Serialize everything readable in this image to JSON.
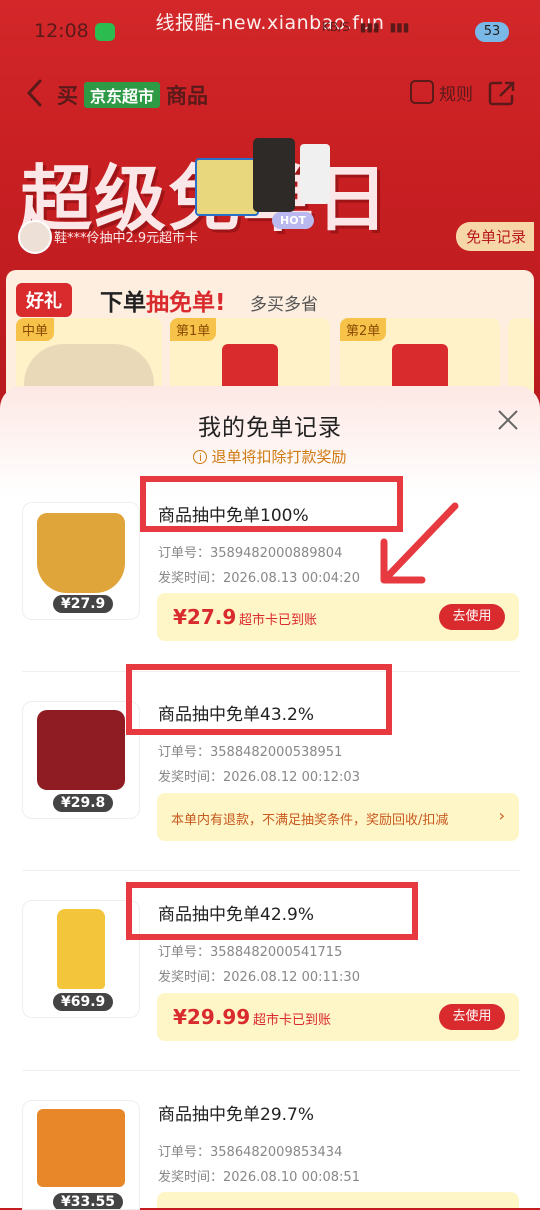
{
  "watermark": "线报酷-new.xianbao.fun",
  "status_bar": {
    "time": "12:08",
    "battery": "53",
    "network_speed": "KB/S"
  },
  "header": {
    "prefix": "买",
    "brand": "京东超市",
    "suffix": "商品",
    "rules_label": "规则"
  },
  "banner": {
    "title": "超级免单日",
    "winner_text": "鞋***伶抽中2.9元超市卡",
    "record_button": "免单记录",
    "hot_badge": "HOT"
  },
  "gift": {
    "tag": "好礼",
    "headline_a": "下单",
    "headline_b": "抽免单",
    "headline_c": "!",
    "sub": "多买多省",
    "cards": [
      {
        "label": "中单"
      },
      {
        "label": "第1单"
      },
      {
        "label": "第2单"
      }
    ]
  },
  "modal": {
    "title": "我的免单记录",
    "notice": "退单将扣除打款奖励",
    "records": [
      {
        "title": "商品抽中免单100%",
        "order_label": "订单号：",
        "order_no": "3589482000889804",
        "time_label": "发奖时间：",
        "time": "2026.08.13 00:04:20",
        "price": "¥27.9",
        "amount": "¥27.9",
        "status": "超市卡已到账",
        "button": "去使用",
        "thumb_color": "#e0a53a"
      },
      {
        "title": "商品抽中免单43.2%",
        "order_label": "订单号：",
        "order_no": "3588482000538951",
        "time_label": "发奖时间：",
        "time": "2026.08.12 00:12:03",
        "price": "¥29.8",
        "warning": "本单内有退款，不满足抽奖条件，奖励回收/扣减",
        "thumb_color": "#8e1c22"
      },
      {
        "title": "商品抽中免单42.9%",
        "order_label": "订单号：",
        "order_no": "3588482000541715",
        "time_label": "发奖时间：",
        "time": "2026.08.12 00:11:30",
        "price": "¥69.9",
        "amount": "¥29.99",
        "status": "超市卡已到账",
        "button": "去使用",
        "thumb_color": "#f3c53a"
      },
      {
        "title": "商品抽中免单29.7%",
        "order_label": "订单号：",
        "order_no": "3586482009853434",
        "time_label": "发奖时间：",
        "time": "2026.08.10 00:08:51",
        "price": "¥33.55",
        "thumb_color": "#e8862a"
      }
    ]
  }
}
